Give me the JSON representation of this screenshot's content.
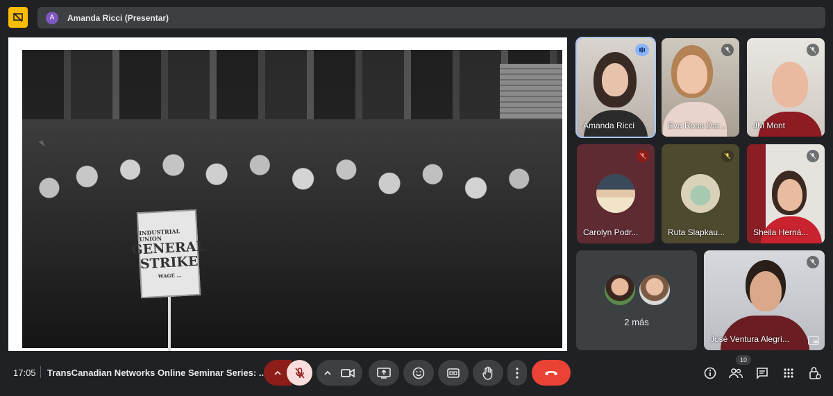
{
  "presenter_bar": {
    "avatar_letter": "A",
    "name": "Amanda Ricci (Presentar)"
  },
  "presentation": {
    "sign_line1": "INDUSTRIAL UNION",
    "sign_line2a": "GENERAL",
    "sign_line2b": "STRIKE",
    "sign_line3": "WAGE ..."
  },
  "participants": [
    {
      "name": "Amanda Ricci",
      "speaking": true
    },
    {
      "name": "Eva Rosa Dar...",
      "muted": true
    },
    {
      "name": "JM Mont",
      "muted": true
    },
    {
      "name": "Carolyn Podr...",
      "muted": true
    },
    {
      "name": "Ruta Slapkau...",
      "muted": true
    },
    {
      "name": "Sheila Herná...",
      "muted": true
    },
    {
      "name": "José Ventura Alegrí...",
      "muted": true
    }
  ],
  "more": {
    "label": "2 más"
  },
  "bottom_bar": {
    "time": "17:05",
    "meeting_title": "TransCanadian Networks Online Seminar Series: ...",
    "participants_count": "10"
  },
  "colors": {
    "background": "#202124",
    "accent_yellow": "#fbbc04",
    "end_call": "#ea4335",
    "mic_off_bg": "#f9dedc",
    "active_outline": "#a8c7fa"
  },
  "icons": [
    "presentation-off-icon",
    "mic-off-icon",
    "camera-icon",
    "present-screen-icon",
    "emoji-icon",
    "captions-icon",
    "raise-hand-icon",
    "more-options-icon",
    "end-call-icon",
    "info-icon",
    "people-icon",
    "chat-icon",
    "activities-icon",
    "host-controls-icon",
    "speaking-icon",
    "picture-in-picture-icon"
  ]
}
